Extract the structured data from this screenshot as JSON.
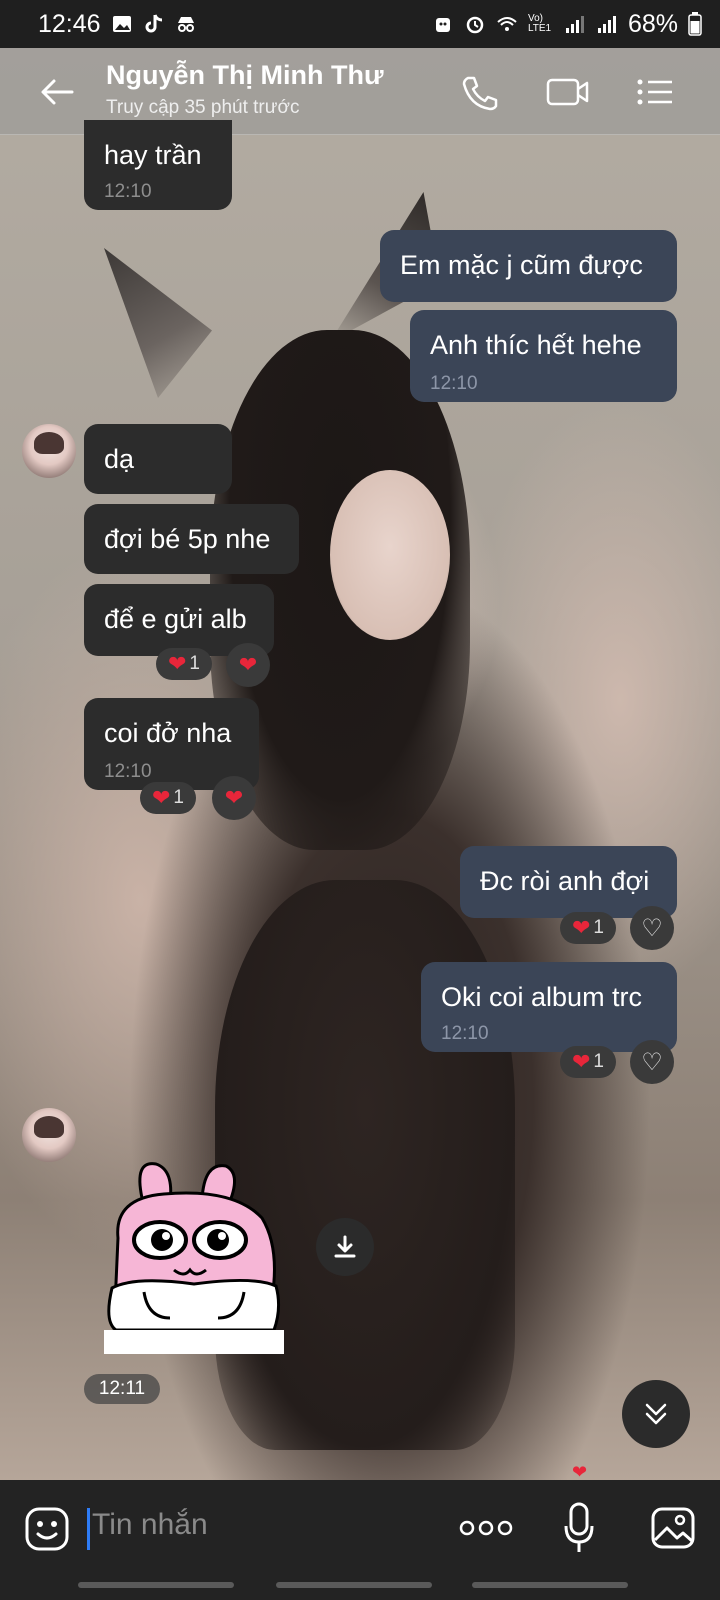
{
  "status_bar": {
    "time": "12:46",
    "battery": "68%",
    "network": "Vo) LTE1"
  },
  "header": {
    "contact_name": "Nguyễn Thị Minh Thư",
    "last_seen": "Truy cập 35 phút trước"
  },
  "messages": [
    {
      "side": "in",
      "text": "hay trần",
      "time": "12:10"
    },
    {
      "side": "out",
      "text": "Em mặc j cũm được"
    },
    {
      "side": "out",
      "text": "Anh thíc hết hehe",
      "time": "12:10"
    },
    {
      "side": "in",
      "text": "dạ"
    },
    {
      "side": "in",
      "text": "đợi bé 5p nhe"
    },
    {
      "side": "in",
      "text": "để e gửi alb",
      "reaction_count": "1"
    },
    {
      "side": "in",
      "text": "coi đở nha",
      "time": "12:10",
      "reaction_count": "1"
    },
    {
      "side": "out",
      "text": "Đc ròi anh đợi",
      "reaction_count": "1"
    },
    {
      "side": "out",
      "text": "Oki coi album trc",
      "time": "12:10",
      "reaction_count": "1"
    }
  ],
  "sticker": {
    "time": "12:11"
  },
  "composer": {
    "placeholder": "Tin nhắn"
  },
  "colors": {
    "incoming_bubble": "#2c2c2c",
    "outgoing_bubble": "#3b4557",
    "heart": "#e8263a",
    "caret": "#2e7cf6"
  }
}
